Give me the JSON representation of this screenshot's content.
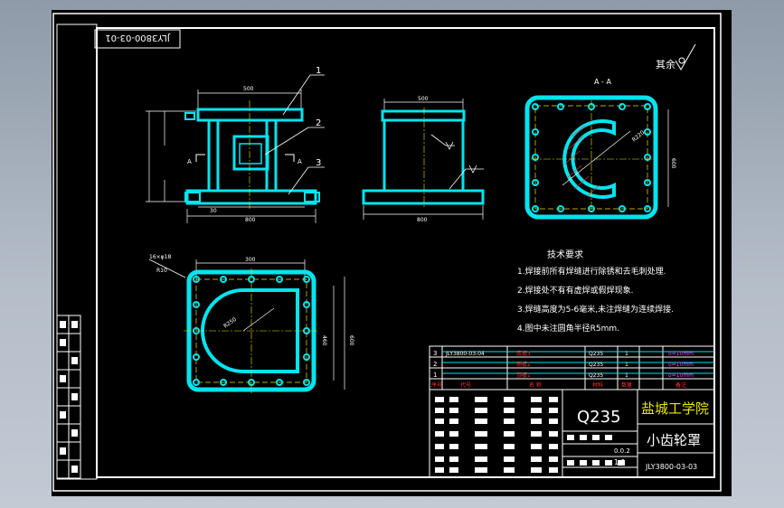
{
  "drawing_number_mirrored": "JLY3800-03-01",
  "roughness_note": "其余",
  "section_label": "A - A",
  "cut_marker": "A",
  "leaders": [
    "1",
    "2",
    "3"
  ],
  "tech_requirements": {
    "title": "技术要求",
    "items": [
      "1.焊接前所有焊缝进行除锈和去毛刺处理.",
      "2.焊接处不有有虚焊或假焊现象.",
      "3.焊缝高度为5-6毫米,未注焊缝为连续焊接.",
      "4.图中未注圆角半径R5mm."
    ]
  },
  "parts_list": [
    {
      "no": "3",
      "code": "JLY3800-03-04",
      "name": "底板3",
      "material": "Q235",
      "qty": "1",
      "note": "δ=10mm"
    },
    {
      "no": "2",
      "code": "",
      "name": "侧板2",
      "material": "Q235",
      "qty": "1",
      "note": "δ=10mm"
    },
    {
      "no": "1",
      "code": "",
      "name": "顶板1",
      "material": "Q235",
      "qty": "1",
      "note": "δ=10mm"
    }
  ],
  "parts_header": [
    "序号",
    "代号",
    "名 称",
    "材料",
    "数量",
    "备注"
  ],
  "title_block": {
    "material": "Q235",
    "school": "盐城工学院",
    "part_name": "小齿轮罩",
    "drawing_no": "JLY3800-03-03",
    "scale_text": "1:1",
    "sheet_text": "0.0.2"
  },
  "colors": {
    "background": "#000000",
    "part_outline": "#00e5ee",
    "frame": "#ffffff",
    "dimension": "#ffffff",
    "centerline": "#e8e800",
    "hatch": "#ff3030"
  }
}
